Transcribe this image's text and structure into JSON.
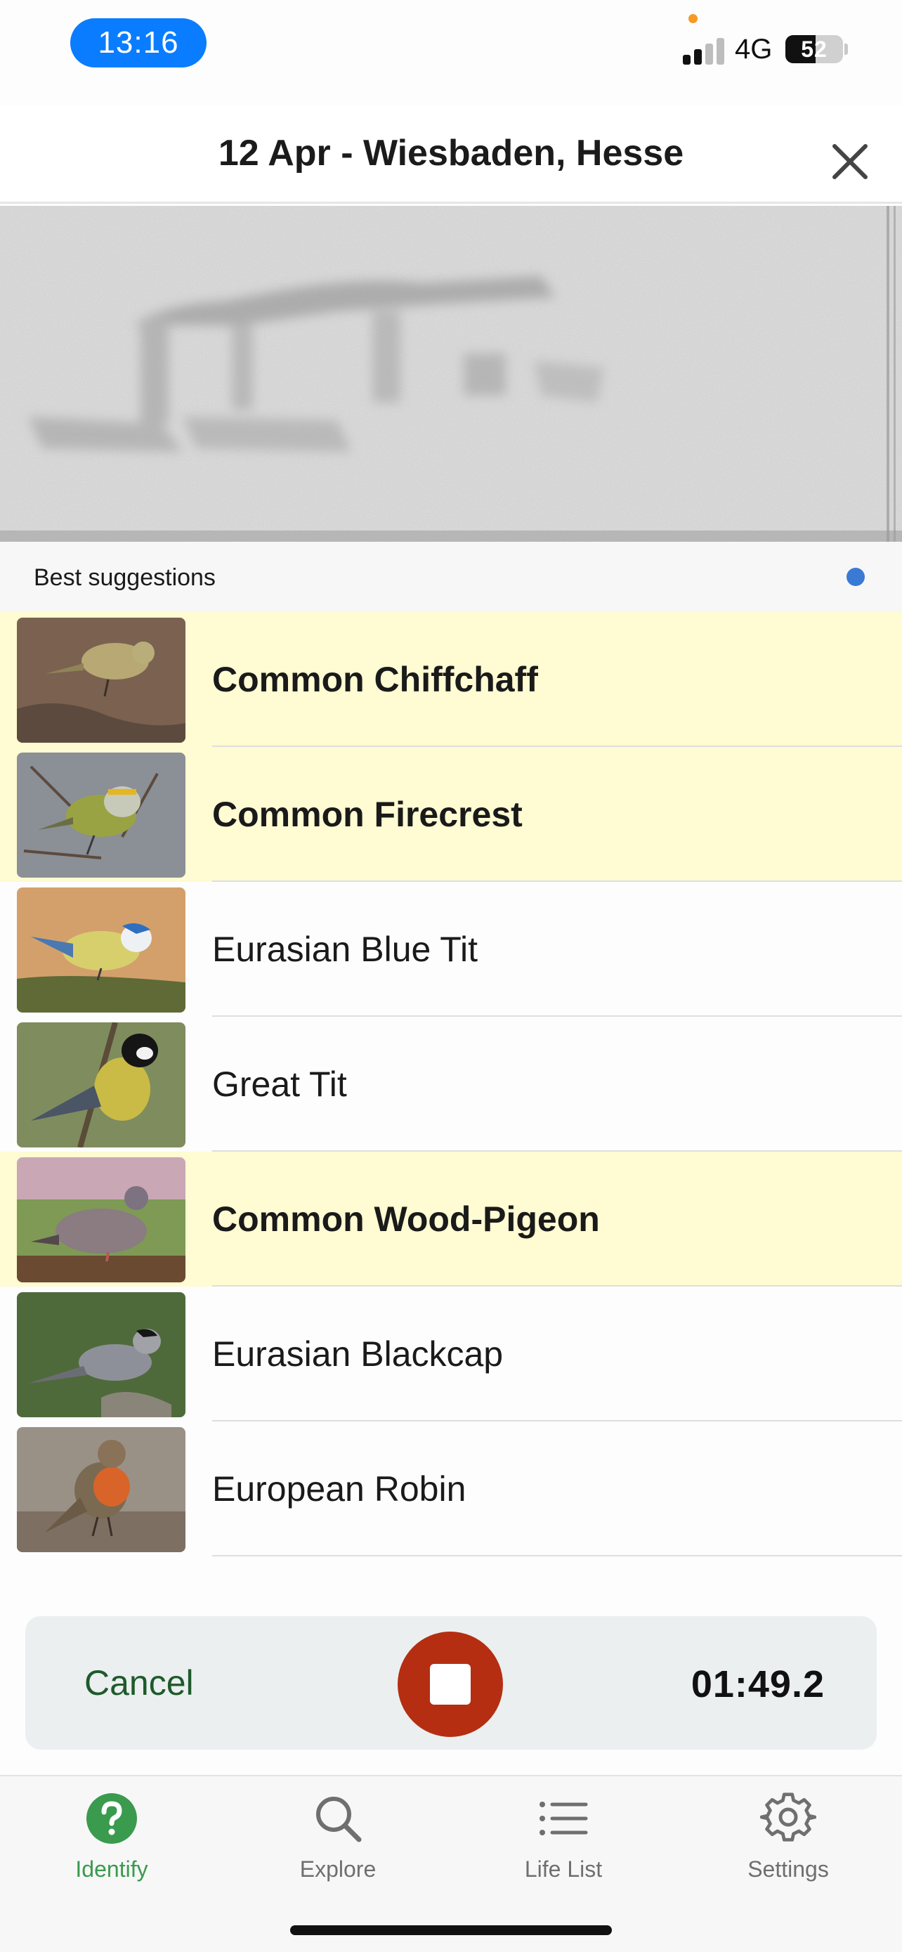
{
  "status_bar": {
    "time": "13:16",
    "network": "4G",
    "battery": "52",
    "battery_level": 0.52
  },
  "header": {
    "title": "12 Apr - Wiesbaden, Hesse",
    "close_icon": "close-icon"
  },
  "suggestions": {
    "label": "Best suggestions",
    "items": [
      {
        "name": "Common Chiffchaff",
        "highlighted": true
      },
      {
        "name": "Common Firecrest",
        "highlighted": true
      },
      {
        "name": "Eurasian Blue Tit",
        "highlighted": false
      },
      {
        "name": "Great Tit",
        "highlighted": false
      },
      {
        "name": "Common Wood-Pigeon",
        "highlighted": true
      },
      {
        "name": "Eurasian Blackcap",
        "highlighted": false
      },
      {
        "name": "European Robin",
        "highlighted": false
      }
    ]
  },
  "recording": {
    "cancel_label": "Cancel",
    "timer": "01:49.2",
    "stop_icon": "stop-icon"
  },
  "tabs": [
    {
      "label": "Identify",
      "icon": "question-icon",
      "active": true
    },
    {
      "label": "Explore",
      "icon": "search-icon",
      "active": false
    },
    {
      "label": "Life List",
      "icon": "list-icon",
      "active": false
    },
    {
      "label": "Settings",
      "icon": "gear-icon",
      "active": false
    }
  ],
  "colors": {
    "accent_green": "#3a9a4e",
    "highlight_yellow": "#fffbd2",
    "stop_red": "#b52e12",
    "time_pill_blue": "#0a7cff"
  }
}
